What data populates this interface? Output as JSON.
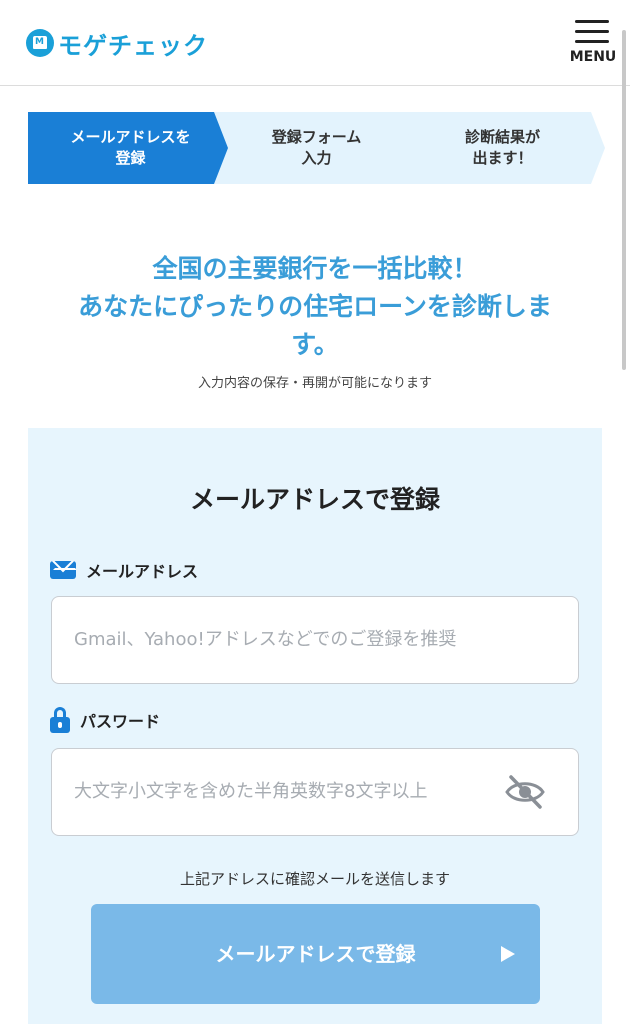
{
  "header": {
    "brand": "モゲチェック",
    "logo_mark_letter": "M",
    "menu_label": "MENU"
  },
  "steps": [
    {
      "label": "メールアドレスを\n登録",
      "state": "active"
    },
    {
      "label": "登録フォーム\n入力",
      "state": "inactive"
    },
    {
      "label": "診断結果が\n出ます！",
      "state": "inactive"
    }
  ],
  "hero": {
    "headline_line1": "全国の主要銀行を一括比較！",
    "headline_line2": "あなたにぴったりの住宅ローンを診断しま",
    "headline_line3": "す。",
    "subnote": "入力内容の保存・再開が可能になります"
  },
  "form": {
    "title": "メールアドレスで登録",
    "email": {
      "label": "メールアドレス",
      "value": "",
      "placeholder": "Gmail、Yahoo!アドレスなどでのご登録を推奨"
    },
    "password": {
      "label": "パスワード",
      "value": "",
      "placeholder": "大文字小文字を含めた半角英数字8文字以上"
    },
    "notice": "上記アドレスに確認メールを送信します",
    "submit_label": "メールアドレスで登録"
  },
  "colors": {
    "brand": "#1aa0d8",
    "step_active": "#1a7fd6",
    "step_inactive": "#e3f3fd",
    "headline": "#3a9dd8",
    "card_bg": "#e7f5fd",
    "button": "#7ab9e8"
  },
  "icons": {
    "logo": "house-logo-icon",
    "menu": "hamburger-menu-icon",
    "email": "envelope-icon",
    "password": "lock-icon",
    "toggle_visibility": "eye-slash-icon",
    "submit_arrow": "play-arrow-icon"
  }
}
